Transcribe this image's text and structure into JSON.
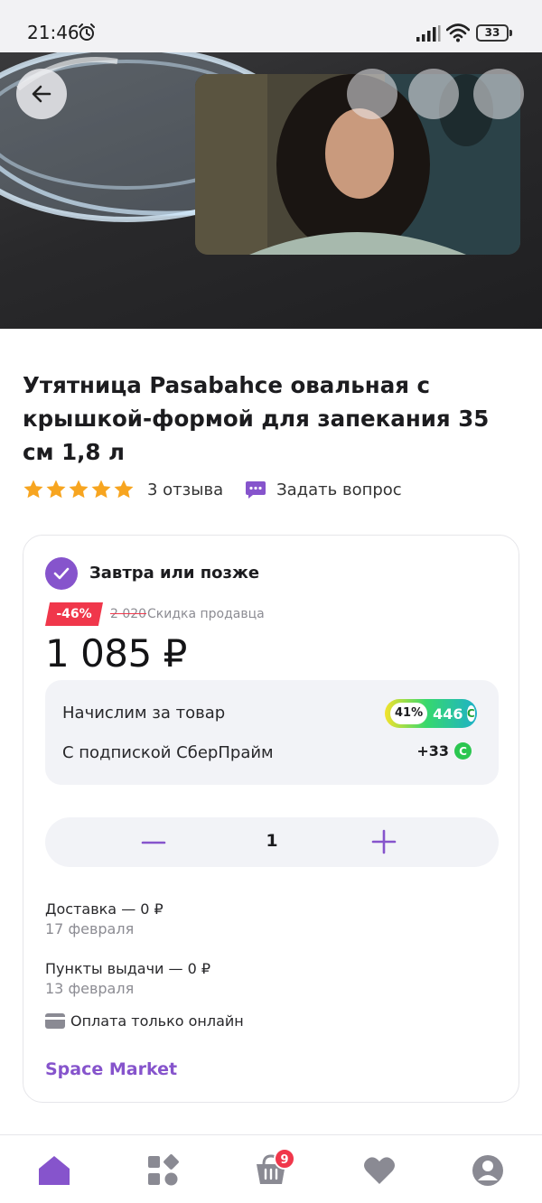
{
  "status_bar": {
    "time": "21:46",
    "battery": "33",
    "icons": [
      "alarm-icon",
      "signal-icon",
      "wifi-icon",
      "battery-icon"
    ]
  },
  "hero": {
    "back_icon": "arrow-left-icon"
  },
  "product": {
    "title": "Утятница Pasabahce овальная с крышкой-формой для запекания 35 см 1,8 л",
    "rating": 5,
    "reviews": "3 отзыва",
    "ask_question": "Задать вопрос"
  },
  "offer": {
    "delivery_when": "Завтра или позже",
    "discount": "-46%",
    "old_price": "2 020",
    "seller_discount": "Скидка продавца",
    "price": "1 085 ₽",
    "bonus": {
      "label": "Начислим за товар",
      "percent": "41%",
      "value": "446",
      "subscription_label": "С подпиской СберПрайм",
      "subscription_value": "+33"
    },
    "quantity": "1",
    "delivery": {
      "courier_title": "Доставка — 0 ₽",
      "courier_date": "17 февраля",
      "pickup_title": "Пункты выдачи — 0 ₽",
      "pickup_date": "13 февраля"
    },
    "payment": "Оплата только онлайн",
    "seller": "Space Market"
  },
  "bottom_nav": {
    "items": [
      "home-icon",
      "catalog-icon",
      "cart-icon",
      "favorites-icon",
      "profile-icon"
    ],
    "cart_badge": "9",
    "accent": "#8654cc",
    "inactive": "#8a8a93"
  },
  "colors": {
    "accent": "#8654cc",
    "discount": "#f0374b",
    "star": "#f7a520",
    "bonus_green": "#2bc650"
  }
}
